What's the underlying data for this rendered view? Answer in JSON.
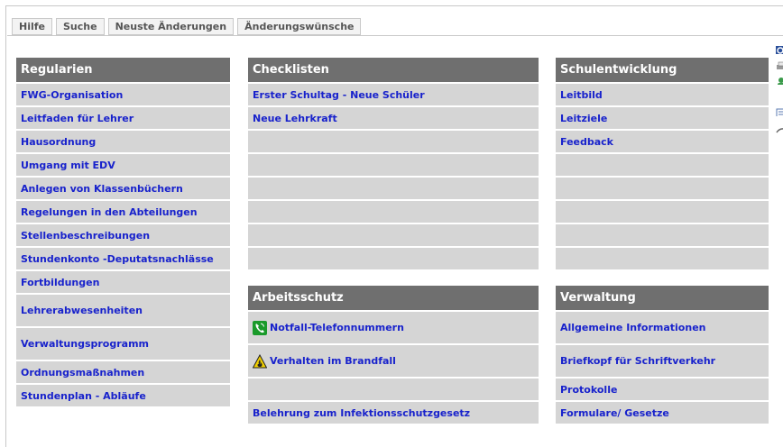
{
  "tabs": [
    "Hilfe",
    "Suche",
    "Neuste Änderungen",
    "Änderungswünsche"
  ],
  "regularien": {
    "title": "Regularien",
    "items": [
      "FWG-Organisation",
      "Leitfaden für Lehrer",
      "Hausordnung",
      "Umgang mit EDV",
      "Anlegen von Klassenbüchern",
      "Regelungen in den Abteilungen",
      "Stellenbeschreibungen",
      "Stundenkonto -Deputatsnachlässe",
      "Fortbildungen",
      "Lehrerabwesenheiten",
      "Verwaltungsprogramm",
      "Ordnungsmaßnahmen",
      "Stundenplan - Abläufe"
    ]
  },
  "checklisten": {
    "title": "Checklisten",
    "items": [
      "Erster Schultag - Neue Schüler",
      "Neue Lehrkraft"
    ]
  },
  "schulentwicklung": {
    "title": "Schulentwicklung",
    "items": [
      "Leitbild",
      "Leitziele",
      "Feedback"
    ]
  },
  "arbeitsschutz": {
    "title": "Arbeitsschutz",
    "items": [
      "Notfall-Telefonnummern",
      "Verhalten im Brandfall",
      "Belehrung zum Infektionsschutzgesetz"
    ]
  },
  "verwaltung": {
    "title": "Verwaltung",
    "items": [
      "Allgemeine Informationen",
      "Briefkopf für Schriftverkehr",
      "Protokolle",
      "Formulare/ Gesetze"
    ]
  },
  "icons": {
    "phone": "phone-icon",
    "fire_warning": "fire-warning-icon"
  },
  "colors": {
    "header_bg": "#6f6f6f",
    "row_bg": "#d5d5d5",
    "link": "#1822cc"
  }
}
